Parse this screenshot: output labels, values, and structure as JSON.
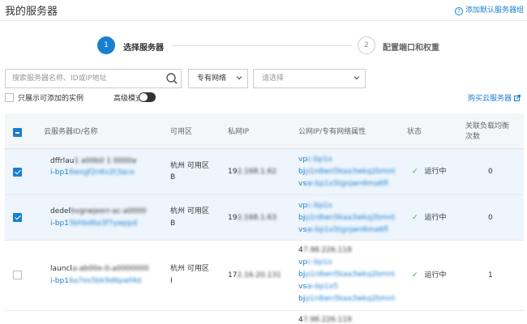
{
  "header": {
    "title": "我的服务器",
    "help_link": "添加默认服务器组"
  },
  "steps": [
    {
      "number": "1",
      "label": "选择服务器",
      "active": true
    },
    {
      "number": "2",
      "label": "配置端口和权重",
      "active": false
    }
  ],
  "filters": {
    "search_placeholder": "搜索服务器名称、ID或IP地址",
    "network_type": "专有网络",
    "vpc_placeholder": "请选择",
    "only_addable_label": "只展示可添加的实例",
    "advanced_mode_label": "高级模式",
    "buy_link": "购买云服务器"
  },
  "table": {
    "headers": {
      "instance": "云服务器ID/名称",
      "zone": "可用区",
      "private_ip": "私网IP",
      "public_ip": "公网IP/专有网络属性",
      "status": "状态",
      "slb_count_line1": "关联负载均衡",
      "slb_count_line2": "次数"
    },
    "rows": [
      {
        "checked": true,
        "name": "dffrlau",
        "name_masked": "1 a00b0 1 0000a",
        "id": "i-bp1",
        "id_masked": "6wxgf2n6v2t3ace",
        "zone_line1": "杭州 可用区",
        "zone_line2": "B",
        "private_ip": "19",
        "private_ip_masked": "2.168.1.62",
        "public_lines": [
          {
            "prefix": "vp",
            "masked": "c-bp1x"
          },
          {
            "prefix": "bj",
            "masked": "p1n8wn5kaa3wkq2bmnt"
          },
          {
            "prefix": "vs",
            "masked": "w-bp1x5tgnjwn6ma6fl"
          }
        ],
        "status": "运行中",
        "slb_count": "0"
      },
      {
        "checked": true,
        "name": "dedel",
        "name_masked": "bvgrwjeerr-ac-a0000",
        "id": "i-bp1",
        "id_masked": "5bhbd6a3f7ywppd",
        "zone_line1": "杭州 可用区",
        "zone_line2": "B",
        "private_ip": "19",
        "private_ip_masked": "2.168.1.63",
        "public_lines": [
          {
            "prefix": "vp",
            "masked": "c-bp1x"
          },
          {
            "prefix": "bj",
            "masked": "p1n8wn5kaa3wkq2bmnt"
          },
          {
            "prefix": "vs",
            "masked": "w-bp1x5tgnjwn6ma6fl"
          }
        ],
        "status": "运行中",
        "slb_count": "0"
      },
      {
        "checked": false,
        "name": "launcl",
        "name_masked": "a-ab00e-0-a0000000",
        "id": "i-bp1",
        "id_masked": "6a7ex5bk9d6pwf4d",
        "zone_line1": "杭州 可用区",
        "zone_line2": "I",
        "private_ip": "17",
        "private_ip_masked": "2.16.20.131",
        "public_lines": [
          {
            "prefix": "4",
            "masked": "7.98.226.118"
          },
          {
            "prefix": "vp",
            "masked": "c-bp1x"
          },
          {
            "prefix": "bj",
            "masked": "p1n8wn5kaa3wkq2bmnt"
          },
          {
            "prefix": "vs",
            "masked": "w-bp1x5"
          },
          {
            "prefix": "bj",
            "masked": "p1n8wn5kaa3wkq2bmnt"
          }
        ],
        "status": "运行中",
        "slb_count": "1"
      },
      {
        "checked": false,
        "name": "",
        "name_masked": "",
        "id": "",
        "id_masked": "",
        "zone_line1": "",
        "zone_line2": "",
        "private_ip": "",
        "private_ip_masked": "",
        "public_lines": [
          {
            "prefix": "4",
            "masked": "7.98.226.119"
          }
        ],
        "status": "",
        "slb_count": ""
      }
    ]
  },
  "colors": {
    "accent": "#1a7fd0",
    "status_ok": "#3aa83a",
    "selected_row": "#eef5fc",
    "header_bg": "#f5f6f8"
  }
}
